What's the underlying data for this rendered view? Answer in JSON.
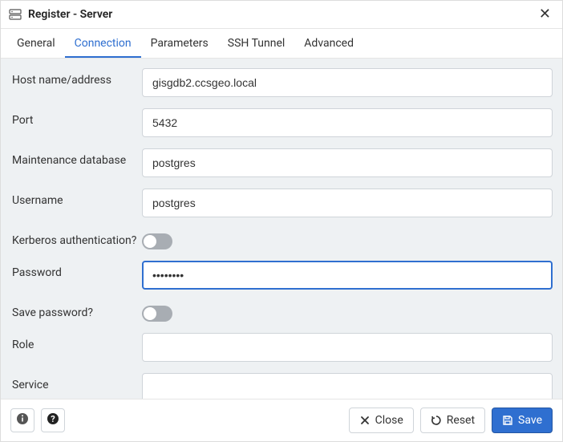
{
  "titlebar": {
    "title": "Register - Server"
  },
  "tabs": [
    {
      "label": "General"
    },
    {
      "label": "Connection"
    },
    {
      "label": "Parameters"
    },
    {
      "label": "SSH Tunnel"
    },
    {
      "label": "Advanced"
    }
  ],
  "active_tab_index": 1,
  "form": {
    "host": {
      "label": "Host name/address",
      "value": "gisgdb2.ccsgeo.local"
    },
    "port": {
      "label": "Port",
      "value": "5432"
    },
    "maintdb": {
      "label": "Maintenance database",
      "value": "postgres"
    },
    "username": {
      "label": "Username",
      "value": "postgres"
    },
    "kerberos": {
      "label": "Kerberos authentication?",
      "value": false
    },
    "password": {
      "label": "Password",
      "value": "••••••••"
    },
    "savepw": {
      "label": "Save password?",
      "value": false
    },
    "role": {
      "label": "Role",
      "value": ""
    },
    "service": {
      "label": "Service",
      "value": ""
    }
  },
  "footer": {
    "close": "Close",
    "reset": "Reset",
    "save": "Save"
  }
}
